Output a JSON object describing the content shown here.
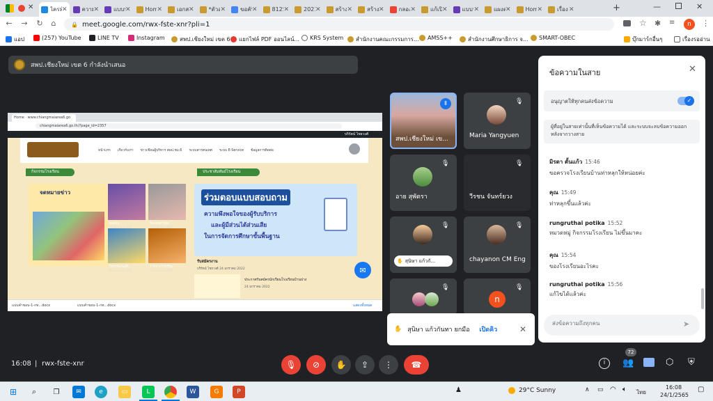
{
  "browser": {
    "tabs": [
      {
        "label": "ไคเท",
        "active": true
      },
      {
        "label": "ไครทั"
      },
      {
        "label": "ความ"
      },
      {
        "label": "แบบป"
      },
      {
        "label": "Home"
      },
      {
        "label": "เอกสา"
      },
      {
        "label": "*ตัวอะ"
      },
      {
        "label": "ขอคับ"
      },
      {
        "label": "8125"
      },
      {
        "label": "2021("
      },
      {
        "label": "สร้าง"
      },
      {
        "label": "สร้าง"
      },
      {
        "label": "กลอง"
      },
      {
        "label": "แก้เปิ"
      },
      {
        "label": "แบบป"
      },
      {
        "label": "แผงค"
      },
      {
        "label": "Home"
      },
      {
        "label": "เรื่อง"
      }
    ],
    "url": "meet.google.com/rwx-fste-xnr?pli=1",
    "profile_initial": "n",
    "bookmarks": [
      {
        "label": "แอป"
      },
      {
        "label": "(257) YouTube"
      },
      {
        "label": "LINE TV"
      },
      {
        "label": "Instagram"
      },
      {
        "label": "สพป.เชียงใหม่ เขต 6"
      },
      {
        "label": "แยกไฟล์ PDF ออนไลน์..."
      },
      {
        "label": "KRS System"
      },
      {
        "label": "สำนักงานคณะกรรมการ..."
      },
      {
        "label": "AMSS++"
      },
      {
        "label": "สำนักงานศึกษาธิการ จ..."
      },
      {
        "label": "SMART-OBEC"
      },
      {
        "label": "บุ๊กมาร์กอื่นๆ"
      },
      {
        "label": "เรื่องรออ่าน"
      }
    ]
  },
  "meet": {
    "presenter_label": "สพป.เชียงใหม่ เขต 6 กำลังนำเสนอ",
    "shared": {
      "tab_label": "Home · www.chiangmaiarea6.go",
      "url": "chiangmaiarea6.go.th/?page_id=2357",
      "nav": [
        "หน้าแรก",
        "เกี่ยวกับเรา",
        "ข่าวเขียนผู้บริหาร สพป.ชม.6",
        "ระบบสารสนเทศ",
        "ระบบ E-Service",
        "ข้อมูลการติดต่อ"
      ],
      "login_text": "บริรัตน์ ไชยวงศ์",
      "activity_label": "กิจกรรมโรงเรียน",
      "pr_label": "ประชาสัมพันธ์โรงเรียน",
      "newsletter": "จดหมายข่าว",
      "banner_title": "ร่วมตอบแบบสอบถาม",
      "banner_line1": "ความพึงพอใจของผู้รับบริการ",
      "banner_line2": "และผู้มีส่วนได้ส่วนเสีย",
      "banner_line3": "ในการจัดการศึกษาขั้นพื้นฐาน",
      "caption1": "รับสมัครงาน",
      "meta1": "บริรัตน์ ไชยวงศ์  24 มกราคม 2022",
      "caption2": "ประกาศรับสมัครนักเรียนโรงเรียนบ้านปาง",
      "meta2": "24 มกราคม 2022",
      "thumb_labels": [
        "ทดสอบ",
        "รับมอบค่าจัดด",
        "กิจกรรมวันเด็ก",
        "ภาพถ่ายโรงเรียน"
      ],
      "thumb_dates": [
        "24 มกราคม 2022",
        "24 มกราคม 2022",
        "24 มกราคม 2022",
        "24 มกราคม 2022"
      ],
      "downloads": [
        "แบบคำขอบ-1-กท...docx",
        "แบบคำขอบ-1-กท...docx"
      ],
      "show_all": "แสดงทั้งหมด"
    },
    "tiles": [
      {
        "name": "สพป.เชียงใหม่ เข..."
      },
      {
        "name": "Maria Yangyuen"
      },
      {
        "name": "อาย สุพัตรา"
      },
      {
        "name": "วีรชน จันทร์ยวง"
      },
      {
        "name": "สุนิษา แก้วกั..."
      },
      {
        "name": "chayanon CM Eng"
      },
      {
        "name": ""
      },
      {
        "name": ""
      }
    ],
    "tile_initial": "n",
    "hand_toast": {
      "text": "สุนิษา แก้วกันทา ยกมือ",
      "action": "เปิดคิว"
    },
    "chat": {
      "title": "ข้อความในสาย",
      "toggle_label": "อนุญาตให้ทุกคนส่งข้อความ",
      "toggle_on": true,
      "notice": "ผู้ที่อยู่ในสายเท่านั้นที่เห็นข้อความได้ และระบบจะลบข้อความออกหลังจากวางสาย",
      "messages": [
        {
          "sender": "มิรดา ตั้นแก้ว",
          "time": "15:46",
          "text": "ขอครวจโรงเรียนบ้านท่าหลุกให้หน่อยค่ะ"
        },
        {
          "sender": "คุณ",
          "time": "15:49",
          "text": "ท่าหลุกขึ้นแล้วค่ะ"
        },
        {
          "sender": "rungruthai potika",
          "time": "15:52",
          "text": "หมวดหมู่ กิจกรรมโรงเรียน ไม่ขึ้นมาคะ"
        },
        {
          "sender": "คุณ",
          "time": "15:54",
          "text": "ของโรงเรียนอะไรคะ"
        },
        {
          "sender": "rungruthai potika",
          "time": "15:56",
          "text": "แก้ไขได้แล้วค่ะ"
        }
      ],
      "input_placeholder": "ส่งข้อความถึงทุกคน"
    },
    "bottom": {
      "time": "16:08",
      "meeting_code": "rwx-fste-xnr",
      "participants_count": "72"
    }
  },
  "taskbar": {
    "weather": "29°C  Sunny",
    "lang": "ไทย",
    "clock_time": "16:08",
    "clock_date": "24/1/2565"
  },
  "colors": {
    "meet_bg": "#202124",
    "tile_bg": "#3c4043",
    "end_call": "#ea4335",
    "accent_blue": "#1a73e8"
  }
}
